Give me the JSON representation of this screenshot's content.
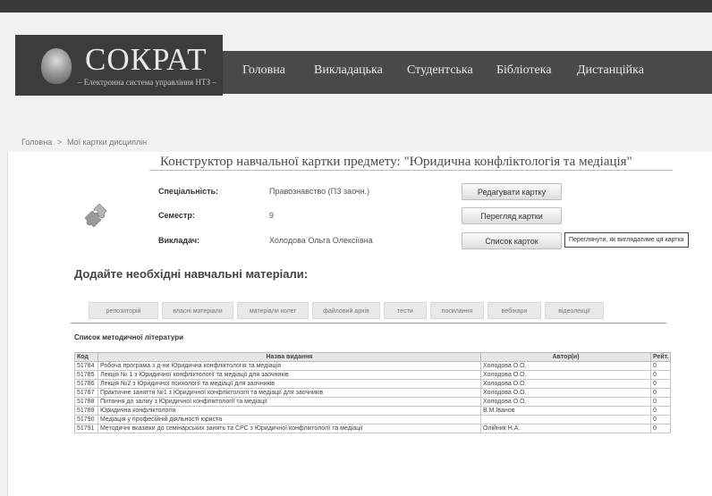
{
  "logo": {
    "title": "СОКРАТ",
    "subtitle": "– Електронна система управління НТЗ –"
  },
  "nav": {
    "items": [
      "Головна",
      "Викладацька",
      "Студентська",
      "Бібліотека",
      "Дистанційка"
    ]
  },
  "breadcrumb": {
    "home": "Головна",
    "separator": ">",
    "current": "Мої картки дисциплін"
  },
  "page": {
    "title": "Конструктор навчальної картки предмету: \"Юридична конфліктологія та медіація\""
  },
  "info": {
    "specialty_label": "Спеціальність:",
    "specialty_value": "Правознавство (ПЗ заочн.)",
    "semester_label": "Семестр:",
    "semester_value": "9",
    "teacher_label": "Викладач:",
    "teacher_value": "Холодова Ольга Олексіївна"
  },
  "buttons": {
    "edit": "Редагувати картку",
    "view": "Перегляд картки",
    "list": "Список карток"
  },
  "tooltip": "Переглянути, як виглядатиме ця картка",
  "materials": {
    "heading": "Додайте необхідні навчальні матеріали:",
    "tabs": [
      "репозиторій",
      "власні матеріали",
      "матеріали колег",
      "файловий архів",
      "тести",
      "посилання",
      "вебінари",
      "відеолекції"
    ]
  },
  "literature": {
    "title": "Список методичної літератури",
    "columns": {
      "code": "Код",
      "name": "Назва видання",
      "author": "Автор(и)",
      "rating": "Рейт."
    },
    "rows": [
      {
        "code": "51784",
        "name": "Робоча програма з д-ни Юридична конфліктологія та медіація",
        "author": "Холодова О.О.",
        "rating": "0"
      },
      {
        "code": "51785",
        "name": "Лекція № 1 з Юридичної конфліктології та медіації для заочників",
        "author": "Холодова О.О.",
        "rating": "0"
      },
      {
        "code": "51786",
        "name": "Лекція №2 з Юридичної психології та медіації для заочників",
        "author": "Холодова О.О.",
        "rating": "0"
      },
      {
        "code": "51787",
        "name": "Практичне заняття №1 з Юридичної конфліктології та медіації для заочників",
        "author": "Холодова О.О.",
        "rating": "0"
      },
      {
        "code": "51788",
        "name": "Питання до заліку з Юридичної конфліктології та медіації",
        "author": "Холодова О.О.",
        "rating": "0"
      },
      {
        "code": "51789",
        "name": "Юридична конфліктологія",
        "author": "В.М.Іванов",
        "rating": "0"
      },
      {
        "code": "51790",
        "name": "Медіація у професійній діяльності юриста",
        "author": "",
        "rating": "0"
      },
      {
        "code": "51791",
        "name": "Методичні вказівки до семінарських занять та СРС з Юридичної конфліктології та медіації",
        "author": "Олійник Н.А.",
        "rating": "0"
      }
    ]
  },
  "colors": {
    "header_dark": "#3c3c3c",
    "nav_bg": "#4a4a4a",
    "page_bg": "#f2f2f2",
    "content_bg": "#ffffff"
  },
  "icons": {
    "logo": "socrates-bust-icon",
    "card": "puzzle-icon"
  }
}
